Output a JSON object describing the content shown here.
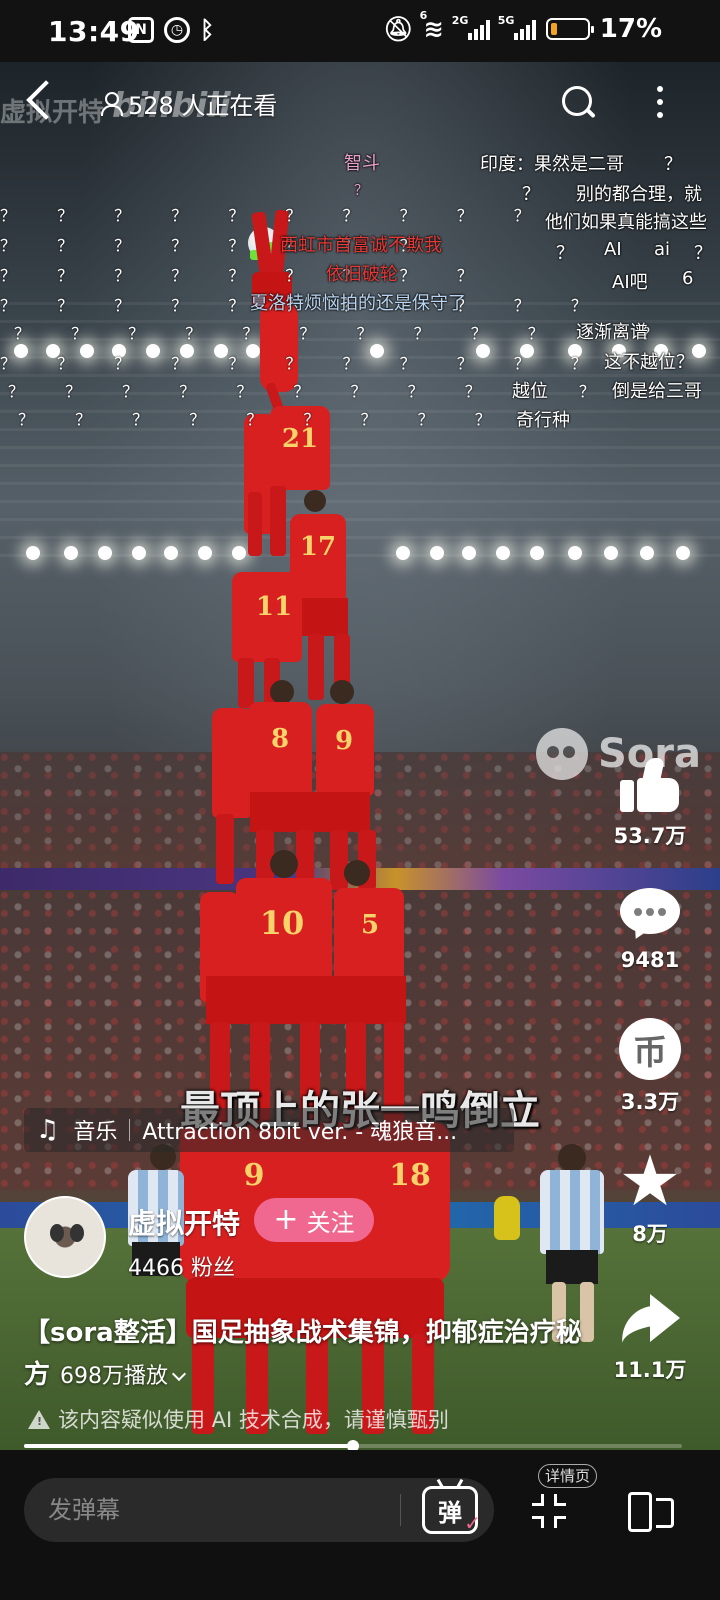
{
  "status_bar": {
    "time": "13:49",
    "battery_percent": "17%",
    "battery_level": 0.17,
    "net_2g": "2G",
    "net_5g": "5G",
    "wifi_num": "6",
    "icons": [
      "nfc-icon",
      "alarm-icon",
      "bluetooth-icon",
      "mute-icon",
      "wifi-icon",
      "signal-icon",
      "battery-icon"
    ]
  },
  "header": {
    "viewers": "528 人正在看",
    "watermark_user": "虚拟开特",
    "watermark_brand": "bilibili"
  },
  "danmaku": [
    {
      "text": "智斗",
      "color": "#e9a0c8"
    },
    {
      "text": "印度：果然是二哥",
      "color": "#ffffff"
    },
    {
      "text": "？",
      "color": "#ffffff"
    },
    {
      "text": "？",
      "color": "#e9a0c8"
    },
    {
      "text": "？",
      "color": "#ffffff"
    },
    {
      "text": "别的都合理，就",
      "color": "#ffffff"
    },
    {
      "text": "他们如果真能搞这些",
      "color": "#ffffff"
    },
    {
      "text": "西虹市首富诚不欺我",
      "color": "#e53935"
    },
    {
      "text": "？",
      "color": "#ffffff"
    },
    {
      "text": "AI",
      "color": "#ffffff"
    },
    {
      "text": "ai",
      "color": "#ffffff"
    },
    {
      "text": "？",
      "color": "#ffffff"
    },
    {
      "text": "依旧破轮",
      "color": "#e53935"
    },
    {
      "text": "AI吧",
      "color": "#ffffff"
    },
    {
      "text": "6",
      "color": "#ffffff"
    },
    {
      "text": "夏洛特烦恼拍的还是保守了",
      "color": "#b8d4f0"
    },
    {
      "text": "逐渐离谱",
      "color": "#ffffff"
    },
    {
      "text": "这不越位？",
      "color": "#ffffff"
    },
    {
      "text": "越位",
      "color": "#ffffff"
    },
    {
      "text": "倒是给三哥",
      "color": "#ffffff"
    },
    {
      "text": "奇行种",
      "color": "#ffffff"
    }
  ],
  "question_marks": "？",
  "sora_watermark": "Sora",
  "jersey_numbers": [
    "21",
    "17",
    "11",
    "8",
    "9",
    "10",
    "5",
    "9",
    "18"
  ],
  "actions": {
    "like": "53.7万",
    "comment": "9481",
    "coin": "3.3万",
    "coin_glyph": "币",
    "favorite": "8万",
    "share": "11.1万"
  },
  "subtitle": "最顶上的张一鸣倒立",
  "music": {
    "label": "音乐",
    "song": "Attraction 8bit ver. - 魂狼音..."
  },
  "uploader": {
    "name": "虚拟开特",
    "fans": "4466 粉丝",
    "follow_label": "关注",
    "follow_plus": "+"
  },
  "video": {
    "title": "【sora整活】国足抽象战术集锦，抑郁症治疗秘方",
    "plays": "698万播放",
    "ai_notice": "该内容疑似使用 AI 技术合成，请谨慎甄别",
    "progress": 0.5
  },
  "bottom_bar": {
    "danmaku_placeholder": "发弹幕",
    "danmaku_button": "弹",
    "detail_tag": "详情页"
  },
  "colors": {
    "follow_button": "#f0688f",
    "danmaku_red": "#e53935",
    "battery_fill": "#f2a323"
  }
}
